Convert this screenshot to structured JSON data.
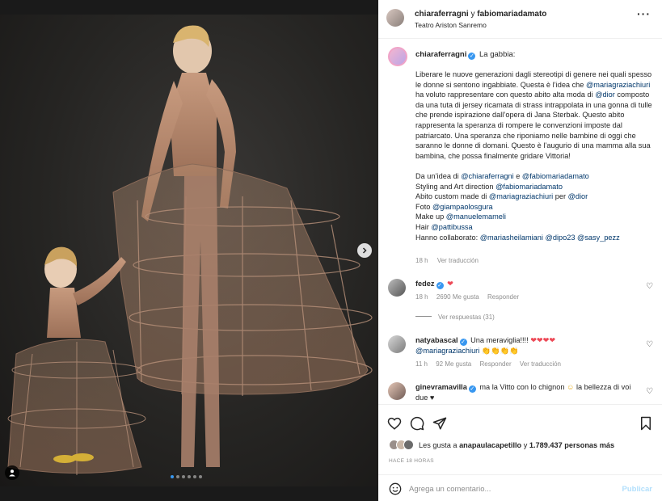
{
  "colors": {
    "accent": "#3897f0",
    "mention": "#00376b",
    "muted": "#8e8e8e",
    "like": "#ed4956"
  },
  "post": {
    "header": {
      "author1": "chiaraferragni",
      "joiner": "y",
      "author2": "fabiomariadamato",
      "location": "Teatro Ariston Sanremo"
    },
    "caption": {
      "username": "chiaraferragni",
      "title": "La gabbia:",
      "line1": "Liberare le nuove generazioni dagli stereotipi di genere nei quali spesso le donne si sentono ingabbiate. Questa è l’idea che ",
      "mention1": "@mariagraziachiuri",
      "line2": " ha voluto rappresentare con questo abito alta moda di ",
      "mention2": "@dior",
      "line3": " composto da una tuta di jersey ricamata di strass intrappolata in una gonna di tulle che prende ispirazione dall’opera di Jana Sterbak. Questo abito rappresenta la speranza di rompere le convenzioni imposte dal patriarcato. Una speranza che riponiamo nelle bambine di oggi che saranno le donne di domani. Questo è l’augurio di una mamma alla sua bambina, che possa finalmente gridare Vittoria!",
      "idea_prefix": "Da un’idea di ",
      "idea_m1": "@chiaraferragni",
      "idea_and": " e ",
      "idea_m2": "@fabiomariadamato",
      "styling_prefix": "Styling and Art direction ",
      "styling_m": "@fabiomariadamato",
      "abito_prefix": "Abito custom made di ",
      "abito_m1": "@mariagraziachiuri",
      "abito_per": " per ",
      "abito_m2": "@dior",
      "foto_prefix": "Foto ",
      "foto_m": "@giampaolosgura",
      "makeup_prefix": "Make up ",
      "makeup_m": "@manuelemameli",
      "hair_prefix": "Hair ",
      "hair_m": "@pattibussa",
      "collab_prefix": "Hanno collaborato: ",
      "collab_m1": "@mariasheilamiani",
      "collab_m2": "@dipo23",
      "collab_m3": "@sasy_pezz",
      "time": "18 h",
      "translate": "Ver traducción"
    },
    "comments": [
      {
        "username": "fedez",
        "text": "",
        "time": "18 h",
        "likes": "2690 Me gusta",
        "reply": "Responder",
        "view_replies": "Ver respuestas (31)"
      },
      {
        "username": "natyabascal",
        "text": "Una meraviglia!!!!",
        "mention": "@mariagraziachiuri",
        "time": "11 h",
        "likes": "92 Me gusta",
        "reply": "Responder",
        "translate": "Ver traducción"
      },
      {
        "username": "ginevramavilla",
        "text_a": "ma la Vitto con lo chignon",
        "text_b": "la bellezza di voi due ♥"
      }
    ],
    "likes": {
      "prefix": "Les gusta a ",
      "user": "anapaulacapetillo",
      "middle": " y ",
      "count": "1.789.437 personas más"
    },
    "time_ago": "HACE 18 HORAS",
    "comment_box": {
      "placeholder": "Agrega un comentario...",
      "publish": "Publicar"
    }
  },
  "icons": [
    "more-icon",
    "next-arrow-icon",
    "tag-person-icon",
    "heart-icon",
    "comment-icon",
    "share-icon",
    "save-icon",
    "emoji-icon",
    "verified-icon"
  ]
}
